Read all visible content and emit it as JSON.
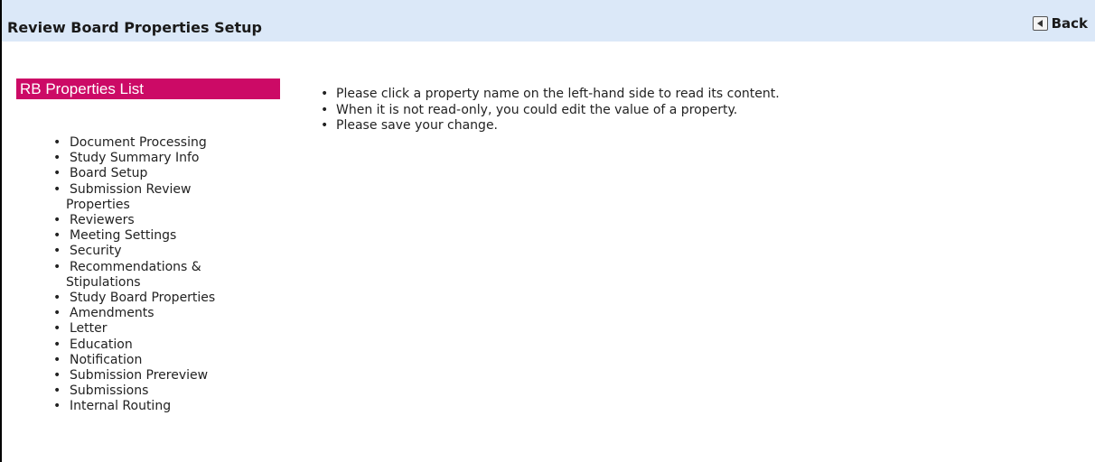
{
  "header": {
    "title": "Review Board Properties Setup",
    "back_label": "Back"
  },
  "sidebar": {
    "title": "RB Properties List",
    "items": [
      {
        "label": "Document Processing"
      },
      {
        "label": "Study Summary Info"
      },
      {
        "label": "Board Setup"
      },
      {
        "label": "Submission Review",
        "label2": "Properties"
      },
      {
        "label": "Reviewers"
      },
      {
        "label": "Meeting Settings"
      },
      {
        "label": "Security"
      },
      {
        "label": "Recommendations &",
        "label2": "Stipulations"
      },
      {
        "label": "Study Board Properties"
      },
      {
        "label": "Amendments"
      },
      {
        "label": "Letter"
      },
      {
        "label": "Education"
      },
      {
        "label": "Notification"
      },
      {
        "label": "Submission Prereview"
      },
      {
        "label": "Submissions"
      },
      {
        "label": "Internal Routing"
      }
    ]
  },
  "main": {
    "instructions": [
      "Please click a property name on the left-hand side to read its content.",
      "When it is not read-only, you could edit the value of a property.",
      "Please save your change."
    ]
  },
  "colors": {
    "header_bg": "#dbe8f8",
    "sidebar_title_bg": "#cc0a66"
  },
  "icons": {
    "back": "back-arrow-icon"
  }
}
